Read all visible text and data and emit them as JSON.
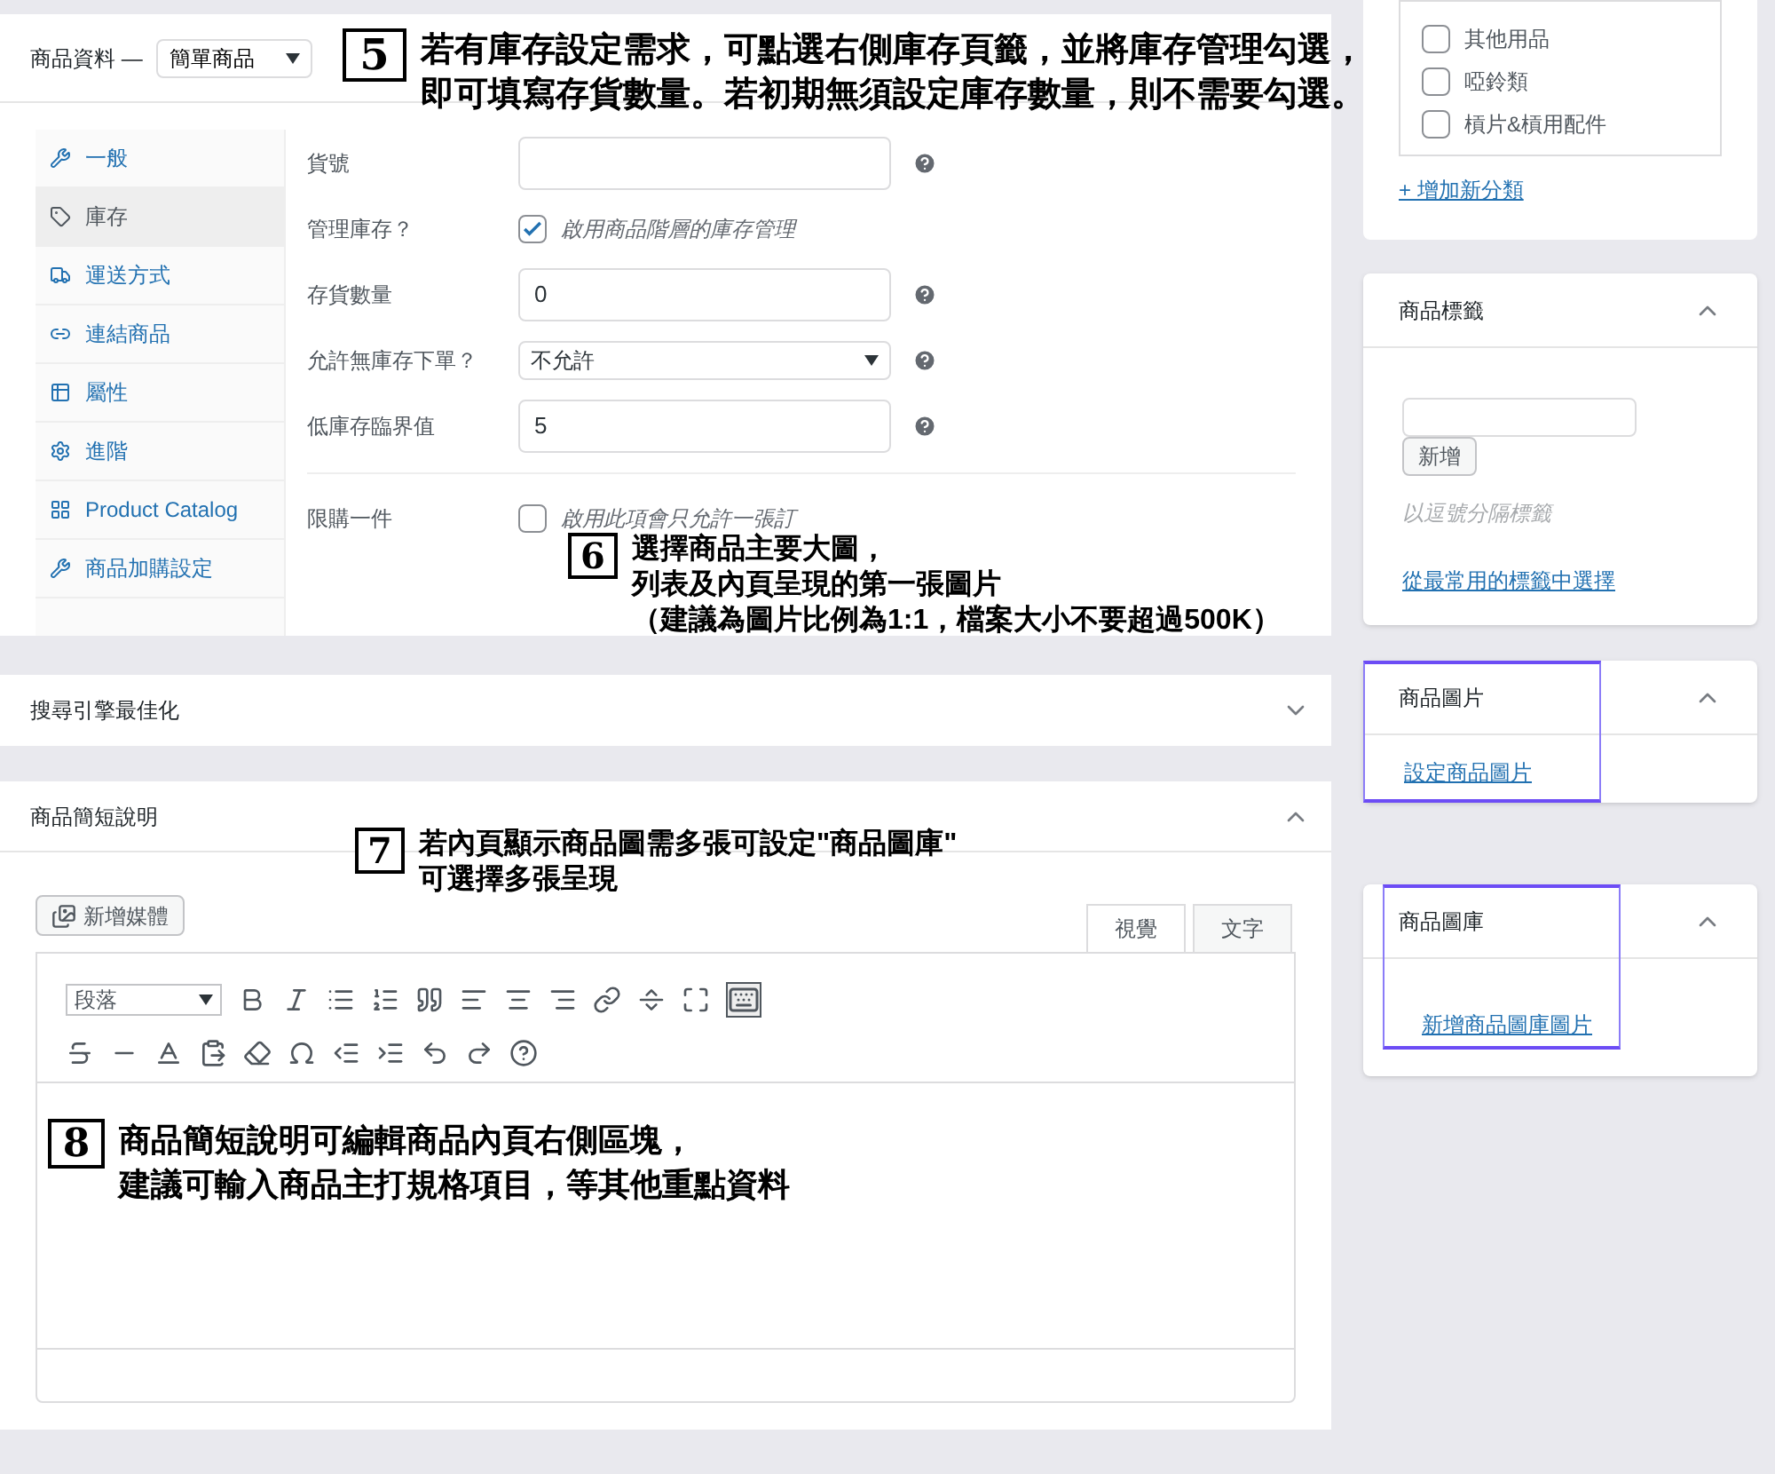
{
  "product_data": {
    "label": "商品資料 —",
    "type_select": "簡單商品",
    "tabs": [
      {
        "label": "一般",
        "selected": false
      },
      {
        "label": "庫存",
        "selected": true
      },
      {
        "label": "運送方式",
        "selected": false
      },
      {
        "label": "連結商品",
        "selected": false
      },
      {
        "label": "屬性",
        "selected": false
      },
      {
        "label": "進階",
        "selected": false
      },
      {
        "label": "Product Catalog",
        "selected": false
      },
      {
        "label": "商品加購設定",
        "selected": false
      }
    ],
    "fields": [
      {
        "kind": "input",
        "label": "貨號"
      },
      {
        "kind": "checkbox",
        "label": "管理庫存？",
        "checked": true,
        "description": "啟用商品階層的庫存管理"
      },
      {
        "kind": "input",
        "label": "存貨數量",
        "value": "0"
      },
      {
        "kind": "select",
        "label": "允許無庫存下單？",
        "value": "不允許"
      },
      {
        "kind": "input",
        "label": "低庫存臨界值",
        "value": "5"
      }
    ],
    "limit_field": {
      "label": "限購一件",
      "checked": false,
      "description": "啟用此項會只允許一張訂"
    }
  },
  "seo_panel": {
    "title": "搜尋引擎最佳化",
    "expanded": false
  },
  "short_description": {
    "title": "商品簡短說明",
    "expanded": true,
    "add_media": "新增媒體",
    "editor_tabs": [
      {
        "label": "視覺",
        "selected": true
      },
      {
        "label": "文字",
        "selected": false
      }
    ],
    "format_select": "段落"
  },
  "categories": {
    "items": [
      {
        "label": "其他用品",
        "checked": false
      },
      {
        "label": "啞鈴類",
        "checked": false
      },
      {
        "label": "槓片&槓用配件",
        "checked": false
      }
    ],
    "add_link": "+ 增加新分類"
  },
  "tags": {
    "title": "商品標籤",
    "expanded": true,
    "add_button": "新增",
    "hint": "以逗號分隔標籤",
    "popular_link": "從最常用的標籤中選擇"
  },
  "product_image": {
    "title": "商品圖片",
    "expanded": true,
    "link": "設定商品圖片"
  },
  "gallery": {
    "title": "商品圖庫",
    "expanded": true,
    "link": "新增商品圖庫圖片"
  },
  "annotations": [
    {
      "number": "5",
      "lines": [
        "若有庫存設定需求，可點選右側庫存頁籤，並將庫存管理勾選，",
        "即可填寫存貨數量。若初期無須設定庫存數量，則不需要勾選。"
      ]
    },
    {
      "number": "6",
      "lines": [
        "選擇商品主要大圖，",
        "列表及內頁呈現的第一張圖片",
        "（建議為圖片比例為1:1，檔案大小不要超過500K）"
      ]
    },
    {
      "number": "7",
      "lines": [
        "若內頁顯示商品圖需多張可設定\"商品圖庫\"",
        "可選擇多張呈現"
      ]
    },
    {
      "number": "8",
      "lines": [
        "商品簡短說明可編輯商品內頁右側區塊，",
        "建議可輸入商品主打規格項目，等其他重點資料"
      ]
    }
  ]
}
